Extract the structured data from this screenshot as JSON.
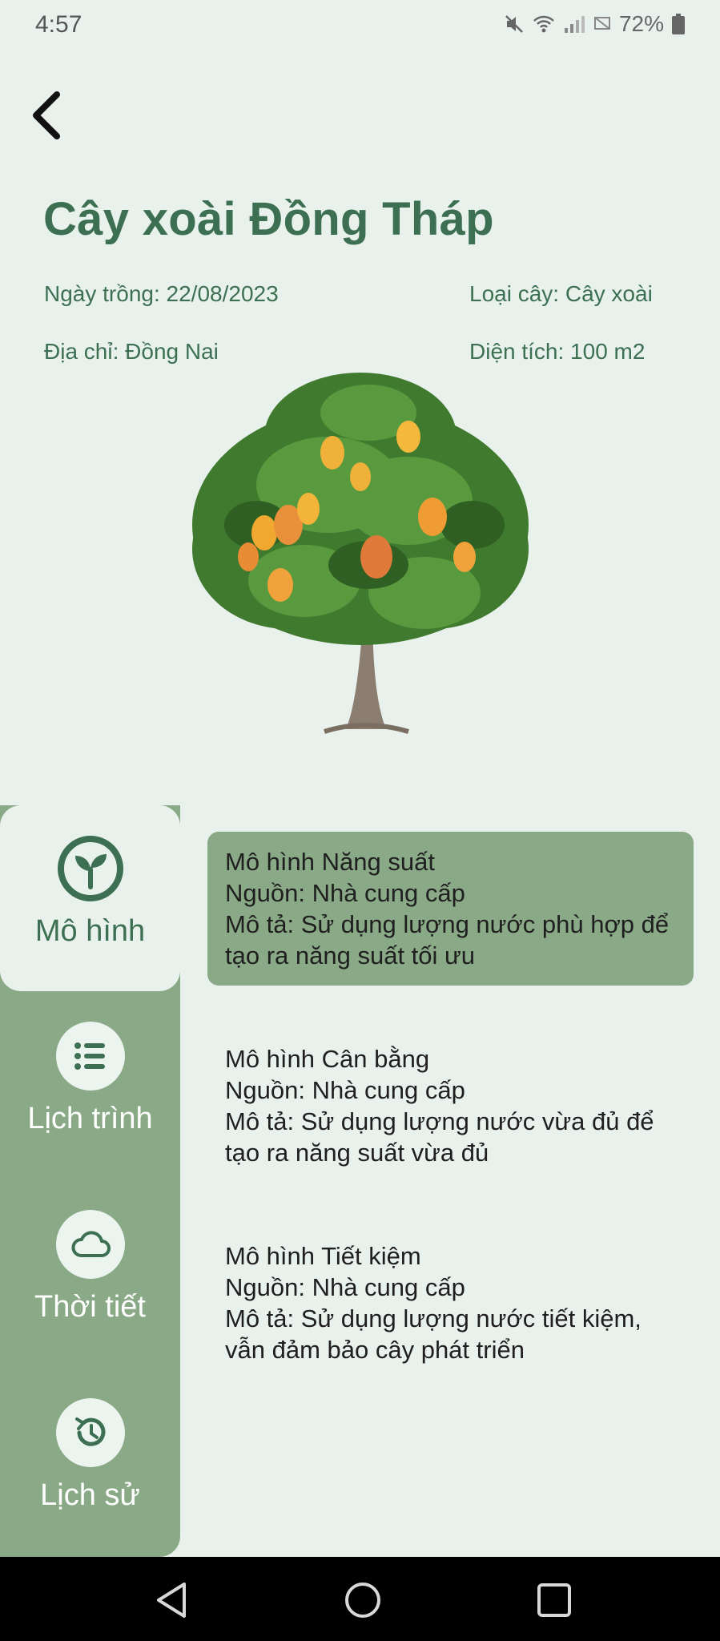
{
  "status": {
    "time": "4:57",
    "battery": "72%"
  },
  "header": {
    "title": "Cây xoài Đồng Tháp"
  },
  "info": {
    "planting_date": "Ngày trồng: 22/08/2023",
    "plant_type": "Loại cây: Cây xoài",
    "address": "Địa chỉ: Đồng Nai",
    "area": "Diện tích: 100 m2"
  },
  "sidebar": {
    "items": [
      {
        "label": "Mô hình",
        "icon": "sprout-icon"
      },
      {
        "label": "Lịch trình",
        "icon": "list-icon"
      },
      {
        "label": "Thời tiết",
        "icon": "cloud-icon"
      },
      {
        "label": "Lịch sử",
        "icon": "history-icon"
      }
    ]
  },
  "models": [
    {
      "name": "Mô hình Năng suất",
      "source": "Nguồn: Nhà cung cấp",
      "desc": "Mô tả: Sử dụng lượng nước phù hợp để tạo ra năng suất tối ưu"
    },
    {
      "name": "Mô hình Cân bằng",
      "source": "Nguồn: Nhà cung cấp",
      "desc": "Mô tả:  Sử dụng lượng nước vừa đủ để tạo ra năng suất vừa đủ"
    },
    {
      "name": "Mô hình Tiết kiệm",
      "source": "Nguồn: Nhà cung cấp",
      "desc": "Mô tả: Sử dụng lượng nước tiết kiệm, vẫn đảm bảo cây phát triển"
    }
  ],
  "colors": {
    "accent": "#3d7052",
    "sidebar": "#8aa987",
    "background": "#e8f1ec"
  }
}
